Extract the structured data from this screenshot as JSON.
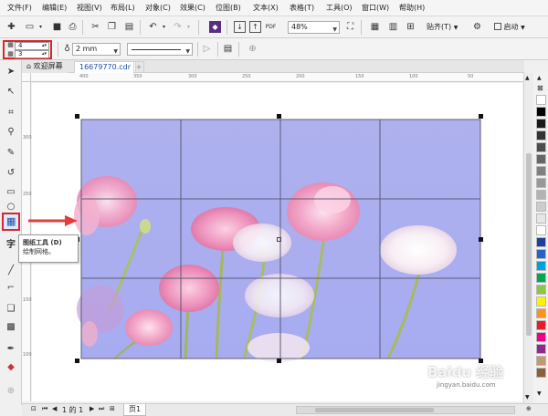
{
  "menubar": {
    "items": [
      "文件(F)",
      "编辑(E)",
      "视图(V)",
      "布局(L)",
      "对象(C)",
      "效果(C)",
      "位图(B)",
      "文本(X)",
      "表格(T)",
      "工具(O)",
      "窗口(W)",
      "帮助(H)"
    ]
  },
  "toolbar": {
    "zoom_value": "48%",
    "snap_label": "贴齐(T)",
    "launch_label": "启动"
  },
  "property_bar": {
    "grid_columns": "4",
    "grid_rows": "3",
    "outline_width": "2 mm"
  },
  "tabs": {
    "welcome_label": "欢迎屏幕",
    "document_label": "16679770.cdr",
    "add_label": "+"
  },
  "ruler": {
    "top_ticks": [
      "400",
      "350",
      "300",
      "250",
      "200",
      "150",
      "100",
      "50"
    ],
    "left_ticks": [
      "300",
      "250",
      "200",
      "150",
      "100"
    ]
  },
  "tooltip": {
    "title": "图纸工具 (D)",
    "description": "绘制网格。"
  },
  "status": {
    "page_info": "1 的 1",
    "page_tab": "页1"
  },
  "watermark": {
    "brand": "Baidu 经验",
    "url": "jingyan.baidu.com"
  },
  "colors": {
    "sky": "#a9aef0",
    "grid_line": "#5b5b75",
    "callout_arrow": "#e23d3d",
    "tool_highlight": "#d62828",
    "palette": [
      "#ffffff",
      "#000000",
      "#1a1a1a",
      "#333333",
      "#4d4d4d",
      "#666666",
      "#808080",
      "#999999",
      "#b3b3b3",
      "#cccccc",
      "#e6e6e6",
      "#ffffff",
      "#1e3f9e",
      "#2563c9",
      "#00a0e0",
      "#00a651",
      "#8dc63f",
      "#fff200",
      "#f7941d",
      "#ed1c24",
      "#ec008c",
      "#92278f",
      "#c49a6c",
      "#8b5e3c"
    ]
  }
}
